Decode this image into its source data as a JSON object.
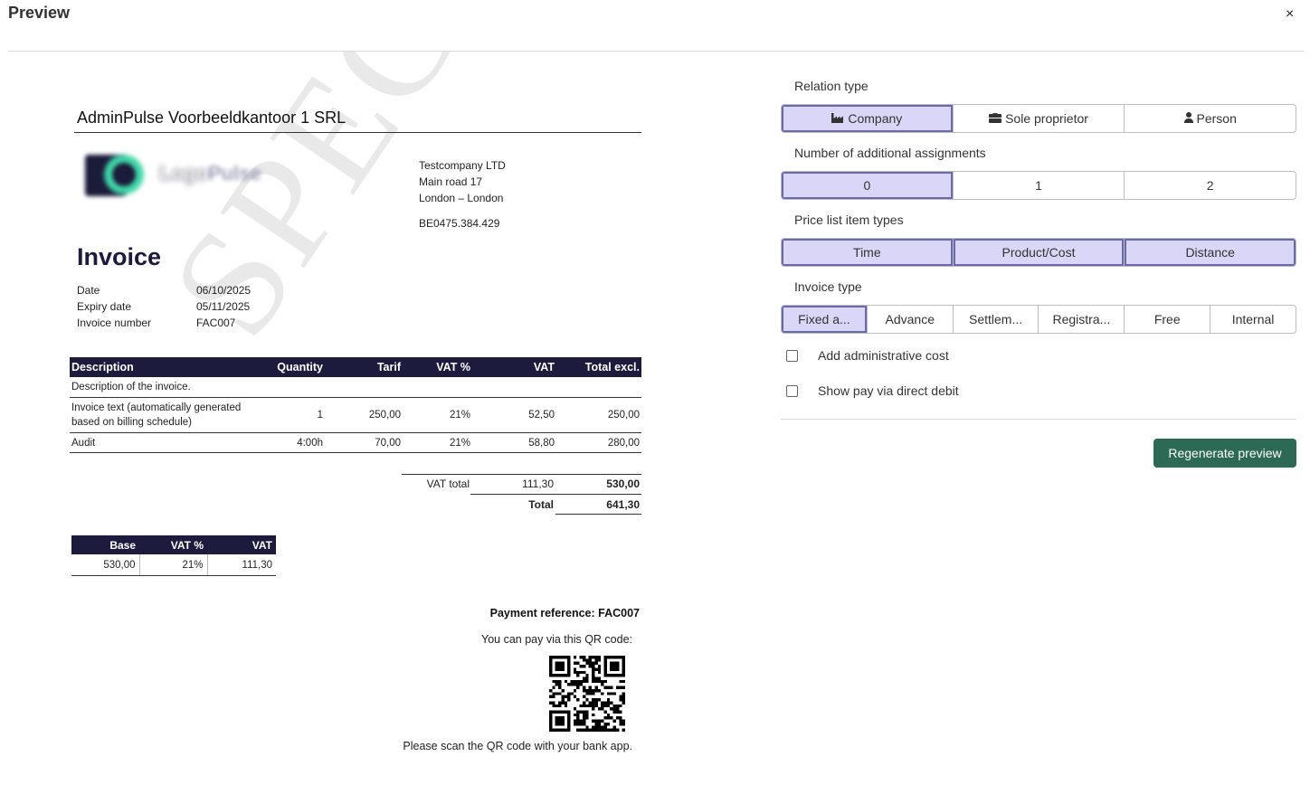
{
  "modal": {
    "title": "Preview",
    "close_label": "×"
  },
  "invoice": {
    "firm_name": "AdminPulse Voorbeeldkantoor 1 SRL",
    "logo": {
      "word": "Logo",
      "word2": "Pulse"
    },
    "watermark": "SPECIMEN",
    "recipient": {
      "name": "Testcompany LTD",
      "street": "Main road 17",
      "city": "London – London",
      "vat_number": "BE0475.384.429"
    },
    "title": "Invoice",
    "meta": {
      "date_label": "Date",
      "date_value": "06/10/2025",
      "expiry_label": "Expiry date",
      "expiry_value": "05/11/2025",
      "number_label": "Invoice number",
      "number_value": "FAC007"
    },
    "lines_table": {
      "headers": [
        "Description",
        "Quantity",
        "Tarif",
        "VAT %",
        "VAT",
        "Total excl."
      ],
      "description_row": "Description of the invoice.",
      "rows": [
        {
          "description": "Invoice text (automatically generated based on billing schedule)",
          "quantity": "1",
          "tarif": "250,00",
          "vat_pct": "21%",
          "vat": "52,50",
          "total": "250,00"
        },
        {
          "description": "Audit",
          "quantity": "4:00h",
          "tarif": "70,00",
          "vat_pct": "21%",
          "vat": "58,80",
          "total": "280,00"
        }
      ]
    },
    "totals": {
      "vat_total_label": "VAT total",
      "vat_total_value": "111,30",
      "excl_total_value": "530,00",
      "total_label": "Total",
      "total_value": "641,30"
    },
    "vat_summary": {
      "headers": [
        "Base",
        "VAT %",
        "VAT"
      ],
      "row": {
        "base": "530,00",
        "vat_pct": "21%",
        "vat": "111,30"
      }
    },
    "payment": {
      "reference": "Payment reference: FAC007",
      "qr_text": "You can pay via this QR code:",
      "scan_text": "Please scan the QR code with your bank app."
    }
  },
  "options": {
    "relation_type": {
      "label": "Relation type",
      "options": [
        {
          "label": "Company",
          "icon": "industry-icon",
          "selected": true
        },
        {
          "label": "Sole proprietor",
          "icon": "briefcase-icon",
          "selected": false
        },
        {
          "label": "Person",
          "icon": "user-icon",
          "selected": false
        }
      ]
    },
    "assignments": {
      "label": "Number of additional assignments",
      "options": [
        {
          "label": "0",
          "selected": true
        },
        {
          "label": "1",
          "selected": false
        },
        {
          "label": "2",
          "selected": false
        }
      ]
    },
    "price_item_types": {
      "label": "Price list item types",
      "options": [
        {
          "label": "Time",
          "selected": true
        },
        {
          "label": "Product/Cost",
          "selected": true
        },
        {
          "label": "Distance",
          "selected": true
        }
      ]
    },
    "invoice_type": {
      "label": "Invoice type",
      "options": [
        {
          "label": "Fixed a...",
          "selected": true
        },
        {
          "label": "Advance",
          "selected": false
        },
        {
          "label": "Settlem...",
          "selected": false
        },
        {
          "label": "Registra...",
          "selected": false
        },
        {
          "label": "Free",
          "selected": false
        },
        {
          "label": "Internal",
          "selected": false
        }
      ]
    },
    "checkboxes": {
      "admin_cost": {
        "label": "Add administrative cost",
        "checked": false
      },
      "direct_debit": {
        "label": "Show pay via direct debit",
        "checked": false
      }
    },
    "regenerate_label": "Regenerate preview"
  },
  "colors": {
    "navy": "#1c1a3d",
    "selected_fill": "#d9d6f7",
    "selected_border": "#6a6aa8",
    "button_green": "#2d6a55"
  }
}
